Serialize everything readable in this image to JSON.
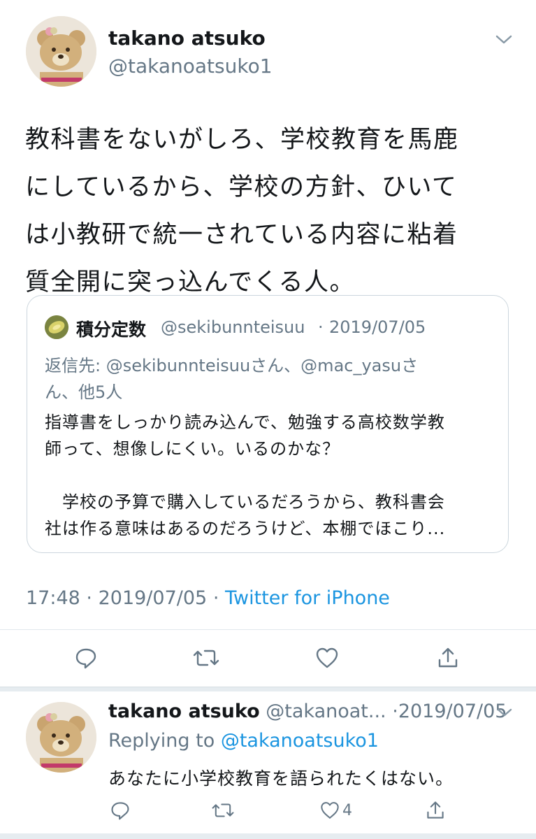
{
  "main_tweet": {
    "display_name": "takano atsuko",
    "handle": "@takanoatsuko1",
    "text": "教科書をないがしろ、学校教育を馬鹿\nにしているから、学校の方針、ひいて\nは小教研で統一されている内容に粘着\n質全開に突っ込んでくる人。",
    "time": "17:48",
    "date": "2019/07/05",
    "meta_sep": "·",
    "source": "Twitter for iPhone"
  },
  "quoted_tweet": {
    "display_name": "積分定数",
    "handle": "@sekibunnteisuu",
    "sep": "·",
    "date": "2019/07/05",
    "reply_line1": "返信先: @sekibunnteisuuさん、@mac_yasuさ",
    "reply_line2": "ん、他5人",
    "body": "指導書をしっかり読み込んで、勉強する高校数学教\n師って、想像しにくい。いるのかな？\n\n　学校の予算で購入しているだろうから、教科書会\n社は作る意味はあるのだろうけど、本棚でほこり..."
  },
  "reply_tweet": {
    "display_name": "takano atsuko",
    "handle": "@takanoat...",
    "sep": "·",
    "date": "2019/07/05",
    "replying_label": "Replying to",
    "replying_handle": "@takanoatsuko1",
    "text": "あなたに小学校教育を語られたくはない。",
    "like_count": "4"
  },
  "icons": {
    "caret": "chevron-down-icon",
    "reply": "reply-icon",
    "retweet": "retweet-icon",
    "like": "heart-icon",
    "share": "share-icon"
  },
  "colors": {
    "text": "#14171a",
    "muted": "#657786",
    "link": "#1b95e0",
    "border": "#e1e8ed"
  }
}
